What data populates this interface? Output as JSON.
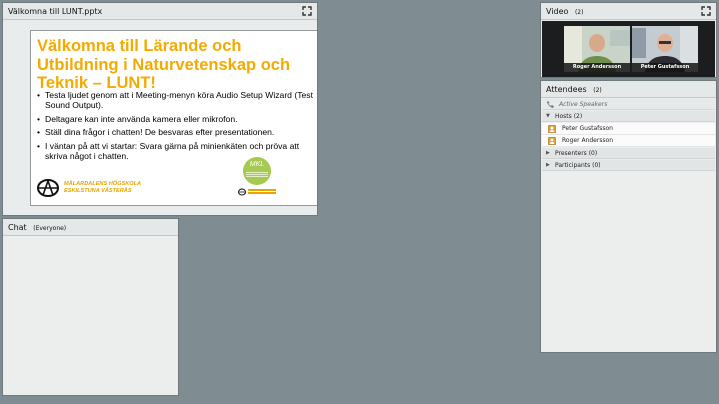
{
  "share_pod": {
    "title": "Välkomna till LUNT.pptx",
    "expand_icon": "expand-icon",
    "slide": {
      "title": "Välkomna till Lärande och Utbildning i Naturvetenskap och Teknik – LUNT!",
      "bullets": [
        "Testa ljudet genom att i Meeting-menyn köra Audio Setup Wizard (Test Sound Output).",
        "Deltagare kan inte använda kamera eller mikrofon.",
        "Ställ dina frågor i chatten! De besvaras efter presentationen.",
        "I väntan på att vi startar: Svara gärna på minienkäten och pröva att skriva något i chatten."
      ],
      "logo_left_line1": "MÄLARDALENS HÖGSKOLA",
      "logo_left_line2": "ESKILSTUNA VÄSTERÅS",
      "logo_right_text": "MKL",
      "accent_color": "#f3ab00"
    }
  },
  "chat_pod": {
    "title": "Chat",
    "scope": "(Everyone)"
  },
  "video_pod": {
    "title": "Video",
    "count": "(2)",
    "expand_icon": "expand-icon",
    "participants": [
      {
        "name": "Roger Andersson"
      },
      {
        "name": "Peter Gustafsson"
      }
    ]
  },
  "attendees_pod": {
    "title": "Attendees",
    "count": "(2)",
    "active_speakers_label": "Active Speakers",
    "groups": {
      "hosts": {
        "label": "Hosts (2)",
        "members": [
          "Peter Gustafsson",
          "Roger Andersson"
        ]
      },
      "presenters": {
        "label": "Presenters (0)"
      },
      "participants": {
        "label": "Participants (0)"
      }
    }
  }
}
